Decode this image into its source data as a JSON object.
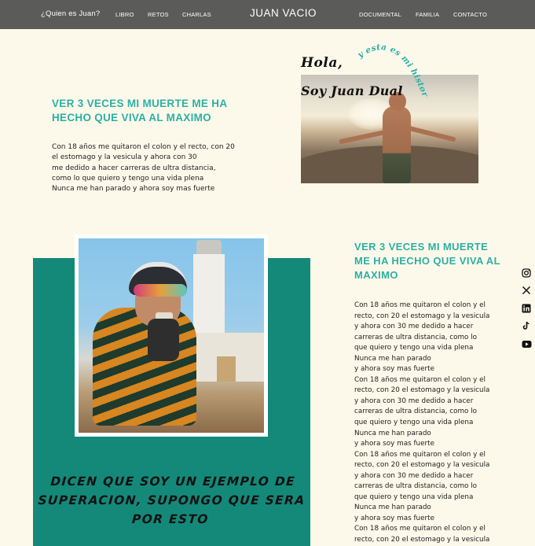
{
  "nav": {
    "quien": "¿Quien es Juan?",
    "libro": "LIBRO",
    "retos": "RETOS",
    "charlas": "CHARLAS",
    "brand": "JUAN VACIO",
    "documental": "DOCUMENTAL",
    "familia": "FAMILIA",
    "contacto": "CONTACTO"
  },
  "hero": {
    "title": "VER 3 VECES MI MUERTE ME HA HECHO QUE VIVA AL MAXIMO",
    "text": "Con 18 años me quitaron el colon y el recto, con 20 el estomago y la vesicula y ahora con 30\nme dedido a hacer carreras de ultra distancia, como lo que quiero y tengo una vida plena\nNunca me han parado y ahora soy mas fuerte",
    "hola": "Hola,",
    "soy": "Soy Juan Dual",
    "arc": "y esta es mi historia"
  },
  "story": {
    "quote": "DICEN QUE SOY UN EJEMPLO DE SUPERACION, SUPONGO QUE SERA POR ESTO",
    "title": "VER 3 VECES MI MUERTE ME HA HECHO QUE VIVA AL MAXIMO",
    "lines": [
      "Con 18 años me quitaron el colon y el",
      "recto, con 20 el estomago y la vesicula",
      "y ahora con 30 me dedido a hacer",
      "carreras de ultra distancia, como lo",
      "que quiero y tengo una vida plena",
      "Nunca me han parado",
      "y ahora soy mas fuerte",
      "Con 18 años me quitaron el colon y el",
      "recto, con 20 el estomago y la vesicula",
      "y ahora con 30 me dedido a hacer",
      "carreras de ultra distancia, como lo",
      "que quiero y tengo una vida plena",
      "Nunca me han parado",
      "y ahora soy mas fuerte",
      "Con 18 años me quitaron el colon y el",
      "recto, con 20 el estomago y la vesicula",
      "y ahora con 30 me dedido a hacer",
      "carreras de ultra distancia, como lo",
      "que quiero y tengo una vida plena",
      "Nunca me han parado",
      "y ahora soy mas fuerte",
      "Con 18 años me quitaron el colon y el",
      "recto, con 20 el estomago y la vesicula"
    ]
  },
  "social": [
    "instagram-icon",
    "x-icon",
    "linkedin-icon",
    "tiktok-icon",
    "youtube-icon"
  ],
  "colors": {
    "nav": "#5b5b59",
    "background": "#fdf9ea",
    "teal": "#14897a",
    "heading": "#2bb0a4"
  }
}
